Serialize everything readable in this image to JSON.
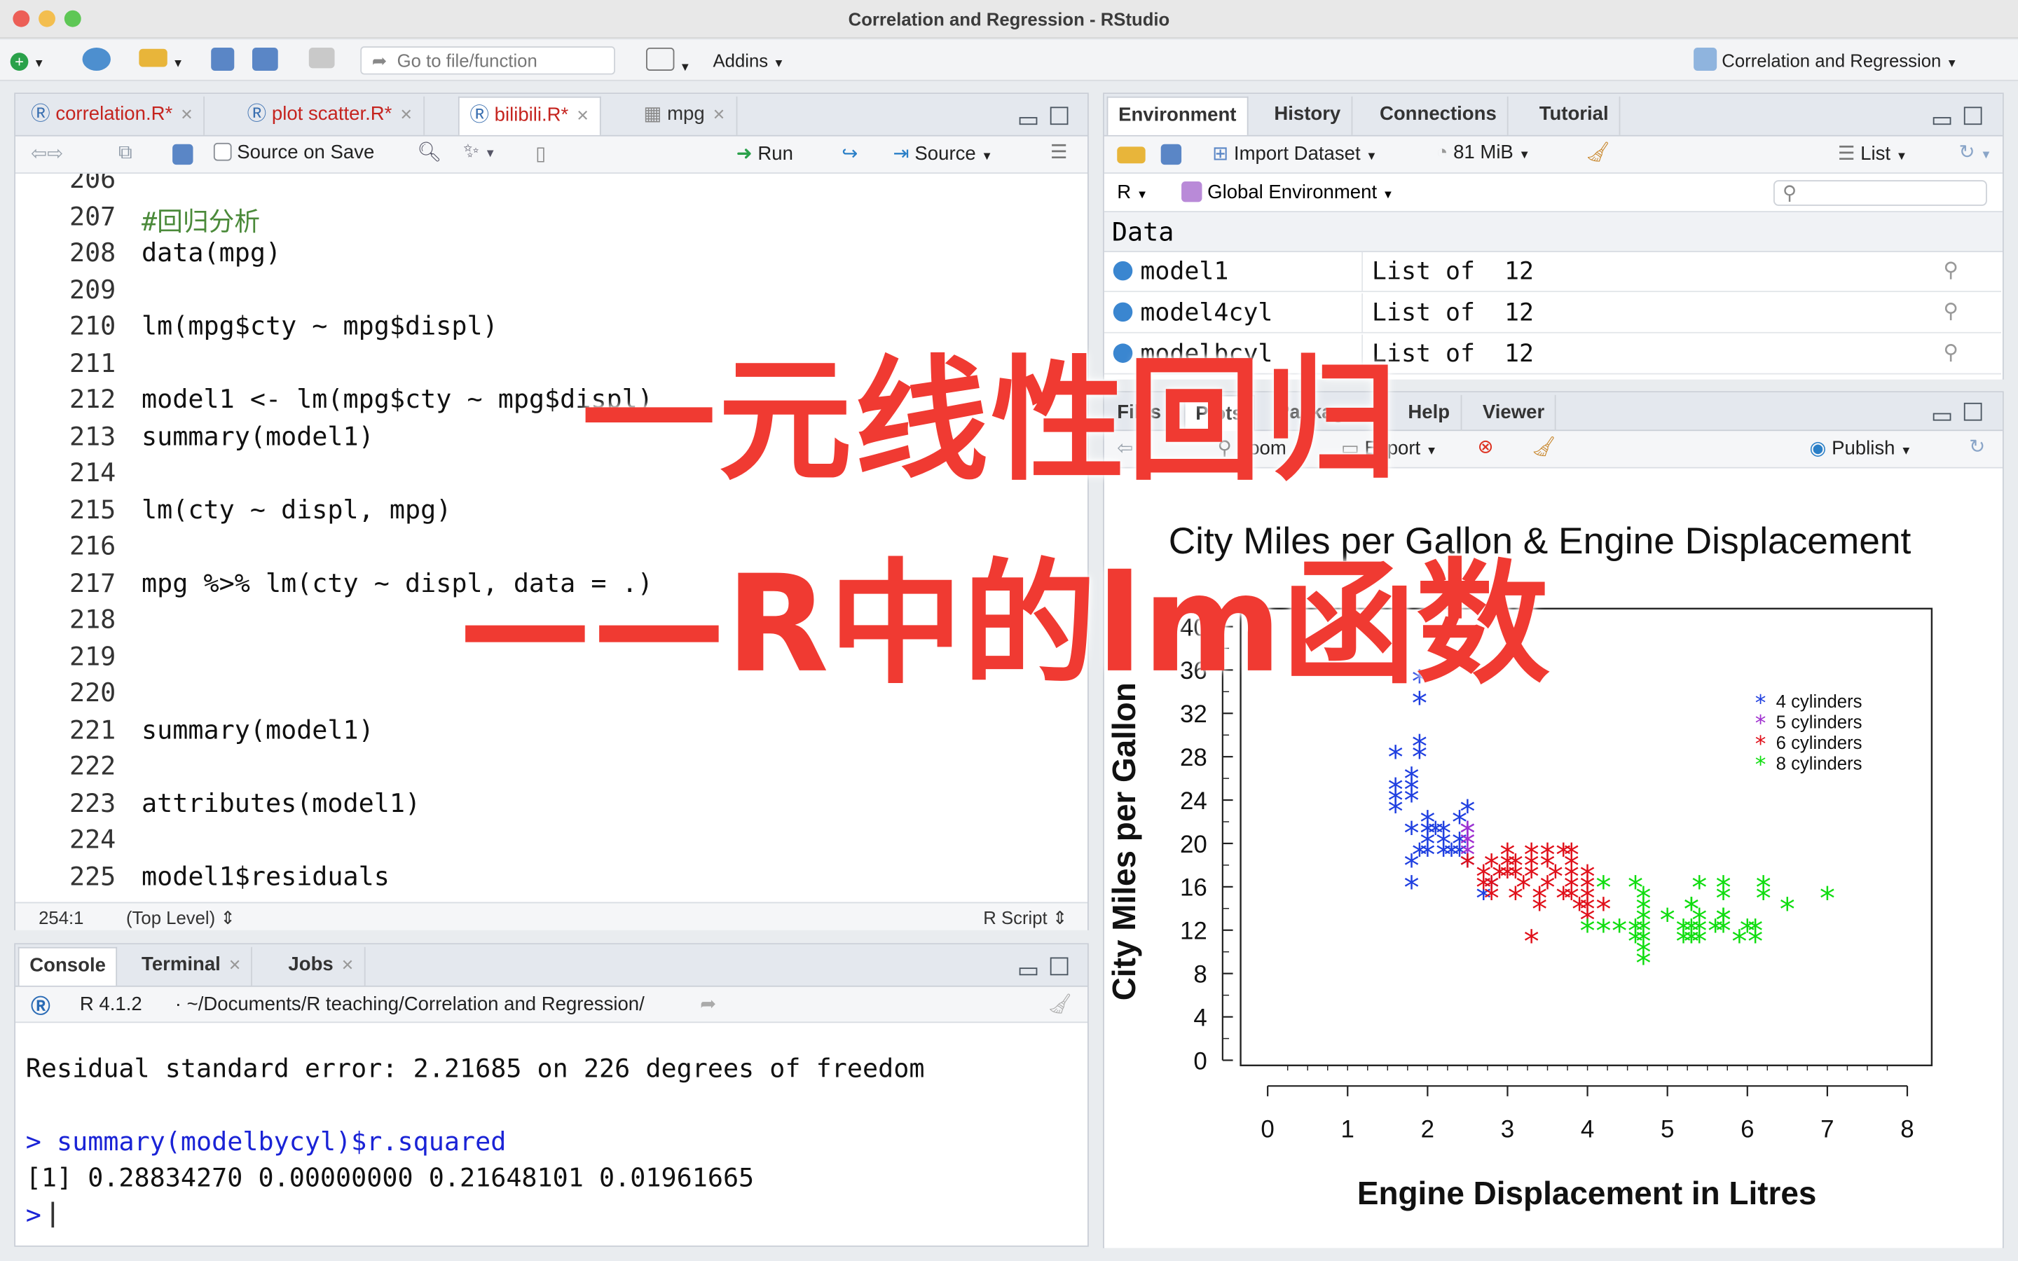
{
  "window": {
    "title": "Correlation and Regression - RStudio"
  },
  "toolbar": {
    "goto_placeholder": "Go to file/function",
    "addins": "Addins",
    "project": "Correlation and Regression"
  },
  "editor": {
    "tabs": [
      {
        "label": "correlation.R*"
      },
      {
        "label": "plot scatter.R*"
      },
      {
        "label": "bilibili.R*"
      },
      {
        "label": "mpg"
      }
    ],
    "source_on_save": "Source on Save",
    "run": "Run",
    "source": "Source",
    "lines": [
      {
        "n": "206",
        "code": ""
      },
      {
        "n": "207",
        "code": "#回归分析"
      },
      {
        "n": "208",
        "code": "data(mpg)"
      },
      {
        "n": "209",
        "code": ""
      },
      {
        "n": "210",
        "code": "lm(mpg$cty ~ mpg$displ)"
      },
      {
        "n": "211",
        "code": ""
      },
      {
        "n": "212",
        "code": "model1 <- lm(mpg$cty ~ mpg$displ)"
      },
      {
        "n": "213",
        "code": "summary(model1)"
      },
      {
        "n": "214",
        "code": ""
      },
      {
        "n": "215",
        "code": "lm(cty ~ displ, mpg)"
      },
      {
        "n": "216",
        "code": ""
      },
      {
        "n": "217",
        "code": "mpg %>% lm(cty ~ displ, data = .)"
      },
      {
        "n": "218",
        "code": ""
      },
      {
        "n": "219",
        "code": ""
      },
      {
        "n": "220",
        "code": ""
      },
      {
        "n": "221",
        "code": "summary(model1)"
      },
      {
        "n": "222",
        "code": ""
      },
      {
        "n": "223",
        "code": "attributes(model1)"
      },
      {
        "n": "224",
        "code": ""
      },
      {
        "n": "225",
        "code": "model1$residuals"
      }
    ],
    "status_pos": "254:1",
    "status_scope": "(Top Level)",
    "status_type": "R Script"
  },
  "console": {
    "tabs": [
      {
        "label": "Console"
      },
      {
        "label": "Terminal"
      },
      {
        "label": "Jobs"
      }
    ],
    "version": "R 4.1.2",
    "path": "· ~/Documents/R teaching/Correlation and Regression/",
    "line1": "Residual standard error: 2.21685 on 226 degrees of freedom",
    "prompt": ">",
    "cmd": "summary(modelbycyl)$r.squared",
    "output": "[1] 0.28834270 0.00000000 0.21648101 0.01961665"
  },
  "env": {
    "tabs": [
      {
        "label": "Environment"
      },
      {
        "label": "History"
      },
      {
        "label": "Connections"
      },
      {
        "label": "Tutorial"
      }
    ],
    "import": "Import Dataset",
    "mem": "81 MiB",
    "list": "List",
    "lang": "R",
    "scope": "Global Environment",
    "section": "Data",
    "rows": [
      {
        "name": "model1",
        "value": "List of  12"
      },
      {
        "name": "model4cyl",
        "value": "List of  12"
      },
      {
        "name": "modelbcyl",
        "value": "List of  12"
      }
    ]
  },
  "files": {
    "tabs": [
      {
        "label": "Files"
      },
      {
        "label": "Plots"
      },
      {
        "label": "Packages"
      },
      {
        "label": "Help"
      },
      {
        "label": "Viewer"
      }
    ],
    "zoom": "Zoom",
    "export": "Export",
    "publish": "Publish"
  },
  "overlay": {
    "line1": "一元线性回归",
    "line2": "——R中的lm函数"
  },
  "colors": {
    "c4": "#1f3fe0",
    "c5": "#a030d0",
    "c6": "#e0101a",
    "c8": "#10dd10",
    "overlay": "#f03a32"
  },
  "chart_data": {
    "type": "scatter",
    "title": "City Miles per Gallon & Engine Displacement",
    "xlabel": "Engine Displacement in Litres",
    "ylabel": "City Miles per Gallon",
    "xlim": [
      0,
      8
    ],
    "ylim": [
      0,
      40
    ],
    "xticks": [
      "0",
      "1",
      "2",
      "3",
      "4",
      "5",
      "6",
      "7",
      "8"
    ],
    "yticks": [
      "0",
      "4",
      "8",
      "12",
      "16",
      "20",
      "24",
      "28",
      "32",
      "36",
      "40"
    ],
    "legend_position": "top-right",
    "marker": "*",
    "series": [
      {
        "name": "4 cylinders",
        "color": "#1f3fe0",
        "points": [
          [
            1.8,
            18
          ],
          [
            1.8,
            21
          ],
          [
            2.0,
            20
          ],
          [
            2.0,
            21
          ],
          [
            2.8,
            16
          ],
          [
            1.8,
            24
          ],
          [
            1.8,
            25
          ],
          [
            1.8,
            26
          ],
          [
            1.9,
            28
          ],
          [
            1.9,
            29
          ],
          [
            1.9,
            33
          ],
          [
            1.9,
            35
          ],
          [
            1.6,
            28
          ],
          [
            1.6,
            24
          ],
          [
            1.6,
            23
          ],
          [
            1.6,
            25
          ],
          [
            2.0,
            19
          ],
          [
            2.0,
            22
          ],
          [
            2.2,
            21
          ],
          [
            2.4,
            19
          ],
          [
            2.4,
            20
          ],
          [
            2.5,
            21
          ],
          [
            2.5,
            23
          ],
          [
            2.2,
            20
          ],
          [
            2.4,
            22
          ],
          [
            2.0,
            21
          ],
          [
            1.8,
            16
          ],
          [
            2.7,
            15
          ],
          [
            2.3,
            19
          ],
          [
            2.5,
            18
          ],
          [
            2.2,
            19
          ],
          [
            1.9,
            19
          ],
          [
            2.1,
            21
          ]
        ]
      },
      {
        "name": "5 cylinders",
        "color": "#a030d0",
        "points": [
          [
            2.5,
            21
          ],
          [
            2.5,
            20
          ],
          [
            2.5,
            20
          ],
          [
            2.5,
            19
          ]
        ]
      },
      {
        "name": "6 cylinders",
        "color": "#e0101a",
        "points": [
          [
            2.8,
            16
          ],
          [
            2.8,
            18
          ],
          [
            3.1,
            18
          ],
          [
            3.1,
            17
          ],
          [
            3.3,
            18
          ],
          [
            3.3,
            17
          ],
          [
            3.8,
            16
          ],
          [
            3.8,
            15
          ],
          [
            3.8,
            17
          ],
          [
            4.0,
            15
          ],
          [
            4.0,
            14
          ],
          [
            4.0,
            17
          ],
          [
            3.4,
            15
          ],
          [
            3.4,
            14
          ],
          [
            3.7,
            15
          ],
          [
            3.9,
            14
          ],
          [
            3.0,
            19
          ],
          [
            3.0,
            17
          ],
          [
            2.7,
            17
          ],
          [
            2.7,
            16
          ],
          [
            3.5,
            19
          ],
          [
            3.5,
            18
          ],
          [
            3.5,
            16
          ],
          [
            3.3,
            11
          ],
          [
            3.8,
            19
          ],
          [
            4.0,
            16
          ],
          [
            4.2,
            14
          ],
          [
            3.6,
            17
          ],
          [
            3.2,
            16
          ],
          [
            2.5,
            18
          ],
          [
            2.8,
            15
          ],
          [
            3.0,
            18
          ],
          [
            3.3,
            19
          ],
          [
            3.7,
            19
          ],
          [
            4.0,
            13
          ],
          [
            3.8,
            18
          ],
          [
            2.9,
            17
          ],
          [
            3.1,
            15
          ]
        ]
      },
      {
        "name": "8 cylinders",
        "color": "#10dd10",
        "points": [
          [
            4.2,
            16
          ],
          [
            5.3,
            14
          ],
          [
            5.3,
            11
          ],
          [
            5.3,
            12
          ],
          [
            5.7,
            15
          ],
          [
            6.0,
            12
          ],
          [
            5.7,
            13
          ],
          [
            5.7,
            16
          ],
          [
            6.2,
            15
          ],
          [
            6.2,
            16
          ],
          [
            7.0,
            15
          ],
          [
            5.3,
            11
          ],
          [
            5.3,
            14
          ],
          [
            5.7,
            12
          ],
          [
            6.5,
            14
          ],
          [
            4.7,
            9
          ],
          [
            4.7,
            12
          ],
          [
            4.7,
            13
          ],
          [
            4.7,
            14
          ],
          [
            4.7,
            15
          ],
          [
            5.2,
            11
          ],
          [
            5.2,
            12
          ],
          [
            5.7,
            13
          ],
          [
            5.9,
            11
          ],
          [
            4.7,
            11
          ],
          [
            4.6,
            12
          ],
          [
            5.4,
            11
          ],
          [
            5.4,
            12
          ],
          [
            5.4,
            13
          ],
          [
            4.0,
            12
          ],
          [
            4.6,
            11
          ],
          [
            5.0,
            13
          ],
          [
            4.2,
            12
          ],
          [
            4.4,
            12
          ],
          [
            5.6,
            12
          ],
          [
            6.1,
            11
          ],
          [
            4.6,
            16
          ],
          [
            4.7,
            10
          ],
          [
            6.1,
            12
          ],
          [
            5.4,
            16
          ]
        ]
      }
    ]
  }
}
